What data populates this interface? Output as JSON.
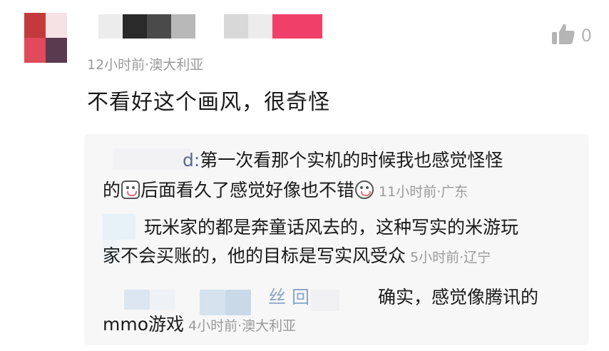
{
  "comment": {
    "meta": "12小时前·澳大利亚",
    "text": "不看好这个画风，很奇怪",
    "like_count": "0",
    "like_icon": "thumbs-up-icon"
  },
  "replies": [
    {
      "name_fragment": "d:",
      "line1": "第一次看那个实机的时候我也感觉怪怪",
      "line2_start": "的",
      "line2_mid": "后面看久了感觉好像也不错",
      "time": "11小时前·广东"
    },
    {
      "line1": "玩米家的都是奔童话风去的，这种写实的米游玩",
      "line2": "家不会买账的，他的目标是写实风受众",
      "time": "5小时前·辽宁"
    },
    {
      "name_fragment": "丝 回",
      "line1": "确实，感觉像腾讯的",
      "line2": "mmo游戏",
      "time": "4小时前·澳大利亚"
    }
  ],
  "colors": {
    "meta": "#9a9a9a",
    "reply_bg": "#f7f7f8",
    "text": "#1a1a1a"
  }
}
